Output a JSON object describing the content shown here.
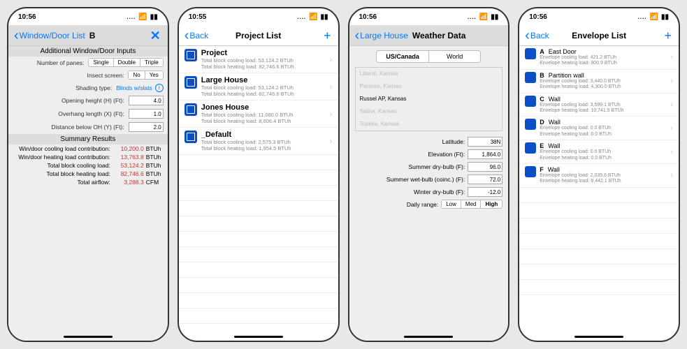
{
  "status": {
    "wifi": "📶",
    "batt": "▮▮"
  },
  "p1": {
    "time": "10:56",
    "back": "Window/Door List",
    "title": "B",
    "section1": "Additional Window/Door Inputs",
    "panes_lbl": "Number of panes:",
    "panes_opts": [
      "Single",
      "Double",
      "Triple"
    ],
    "screen_lbl": "Insect screen:",
    "screen_opts": [
      "No",
      "Yes"
    ],
    "shade_lbl": "Shading type:",
    "shade_val": "Blinds w/slats",
    "oh_lbl": "Opening height (H) (Ft):",
    "oh_val": "4.0",
    "ol_lbl": "Overhang length (X) (Ft):",
    "ol_val": "1.0",
    "od_lbl": "Distance below OH (Y) (Ft):",
    "od_val": "2.0",
    "section2": "Summary Results",
    "rows": [
      {
        "lbl": "Win/door cooling load contribution:",
        "val": "10,200.0",
        "unit": "BTUh"
      },
      {
        "lbl": "Win/door heating load contribution:",
        "val": "13,763.8",
        "unit": "BTUh"
      },
      {
        "lbl": "Total block cooling load:",
        "val": "53,124.2",
        "unit": "BTUh"
      },
      {
        "lbl": "Total block heating load:",
        "val": "82,746.6",
        "unit": "BTUh"
      },
      {
        "lbl": "Total airflow:",
        "val": "3,288.3",
        "unit": "CFM"
      }
    ]
  },
  "p2": {
    "time": "10:55",
    "back": "Back",
    "title": "Project List",
    "items": [
      {
        "title": "Project",
        "s1": "Total block cooling load: 53,124.2 BTUh",
        "s2": "Total block heating load: 82,746.6 BTUh"
      },
      {
        "title": "Large House",
        "s1": "Total block cooling load: 53,124.2 BTUh",
        "s2": "Total block heating load: 82,746.6 BTUh"
      },
      {
        "title": "Jones House",
        "s1": "Total block cooling load: 11,080.0 BTUh",
        "s2": "Total block heating load: 8,606.4 BTUh"
      },
      {
        "title": "_Default",
        "s1": "Total block cooling load: 2,575.3 BTUh",
        "s2": "Total block heating load: 1,954.5 BTUh"
      }
    ]
  },
  "p3": {
    "time": "10:56",
    "back": "Large House",
    "title": "Weather Data",
    "seg": [
      "US/Canada",
      "World"
    ],
    "picker": [
      "Liberal, Kansas",
      "Parsons, Kansas",
      "Russel AP, Kansas",
      "Salina, Kansas",
      "Topeka, Kansas"
    ],
    "picker_sel": 2,
    "fields": [
      {
        "lbl": "Latitude:",
        "val": "38N"
      },
      {
        "lbl": "Elevation (Ft):",
        "val": "1,864.0"
      },
      {
        "lbl": "Summer dry-bulb (F):",
        "val": "96.0"
      },
      {
        "lbl": "Summer wet-bulb (coinc.) (F):",
        "val": "72.0"
      },
      {
        "lbl": "Winter dry-bulb (F):",
        "val": "-12.0"
      }
    ],
    "range_lbl": "Daily range:",
    "range_opts": [
      "Low",
      "Med",
      "High"
    ]
  },
  "p4": {
    "time": "10:56",
    "back": "Back",
    "title": "Envelope List",
    "items": [
      {
        "k": "A",
        "n": "East Door",
        "s1": "Envelope cooling load: 421.2 BTUh",
        "s2": "Envelope heating load: 900.9 BTUh"
      },
      {
        "k": "B",
        "n": "Partition wall",
        "s1": "Envelope cooling load: 3,440.0 BTUh",
        "s2": "Envelope heating load: 4,300.0 BTUh"
      },
      {
        "k": "C",
        "n": "Wall",
        "s1": "Envelope cooling load: 3,599.1 BTUh",
        "s2": "Envelope heating load: 10,741.5 BTUh"
      },
      {
        "k": "D",
        "n": "Wall",
        "s1": "Envelope cooling load: 0.0 BTUh",
        "s2": "Envelope heating load: 0.0 BTUh"
      },
      {
        "k": "E",
        "n": "Wall",
        "s1": "Envelope cooling load: 0.0 BTUh",
        "s2": "Envelope heating load: 0.0 BTUh"
      },
      {
        "k": "F",
        "n": "Wall",
        "s1": "Envelope cooling load: 2,035.6 BTUh",
        "s2": "Envelope heating load: 9,442.1 BTUh"
      }
    ]
  }
}
